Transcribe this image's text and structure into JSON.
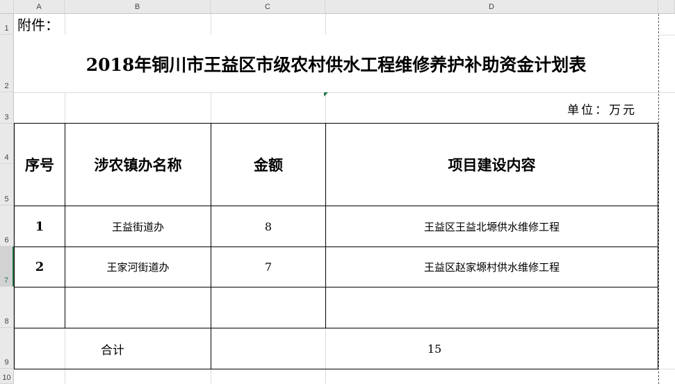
{
  "sheet": {
    "columns": [
      "A",
      "B",
      "C",
      "D"
    ],
    "rows": [
      "1",
      "2",
      "3",
      "4",
      "5",
      "6",
      "7",
      "8",
      "9",
      "10"
    ]
  },
  "attachment_label": "附件：",
  "title": "2018年铜川市王益区市级农村供水工程维修养护补助资金计划表",
  "unit_label": "单位：万元",
  "table": {
    "headers": {
      "seq": "序号",
      "town": "涉农镇办名称",
      "amount": "金额",
      "content": "项目建设内容"
    },
    "rows": [
      {
        "seq": "1",
        "town": "王益街道办",
        "amount": "8",
        "content": "王益区王益北塬供水维修工程"
      },
      {
        "seq": "2",
        "town": "王家河街道办",
        "amount": "7",
        "content": "王益区赵家塬村供水维修工程"
      }
    ],
    "total_label": "合计",
    "total_value": "15"
  },
  "colors": {
    "border": "#000000",
    "header_bg": "#e9e9e9",
    "gridline": "#dcdcdc",
    "selected_row": "#217346"
  }
}
